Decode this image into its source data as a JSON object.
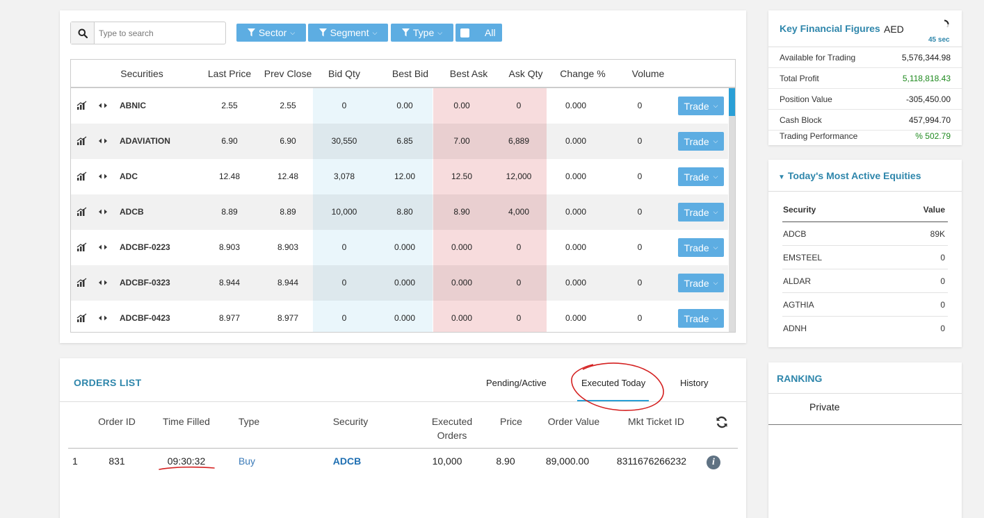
{
  "search": {
    "placeholder": "Type to search"
  },
  "filters": {
    "sector": "Sector",
    "segment": "Segment",
    "type": "Type",
    "all": "All"
  },
  "market_table": {
    "columns": [
      "Securities",
      "Last Price",
      "Prev Close",
      "Bid Qty",
      "Best Bid",
      "Best Ask",
      "Ask Qty",
      "Change %",
      "Volume"
    ],
    "trade_label": "Trade",
    "rows": [
      {
        "security": "ABNIC",
        "last": "2.55",
        "prev": "2.55",
        "bid_qty": "0",
        "best_bid": "0.00",
        "best_ask": "0.00",
        "ask_qty": "0",
        "change": "0.000",
        "volume": "0"
      },
      {
        "security": "ADAVIATION",
        "last": "6.90",
        "prev": "6.90",
        "bid_qty": "30,550",
        "best_bid": "6.85",
        "best_ask": "7.00",
        "ask_qty": "6,889",
        "change": "0.000",
        "volume": "0"
      },
      {
        "security": "ADC",
        "last": "12.48",
        "prev": "12.48",
        "bid_qty": "3,078",
        "best_bid": "12.00",
        "best_ask": "12.50",
        "ask_qty": "12,000",
        "change": "0.000",
        "volume": "0"
      },
      {
        "security": "ADCB",
        "last": "8.89",
        "prev": "8.89",
        "bid_qty": "10,000",
        "best_bid": "8.80",
        "best_ask": "8.90",
        "ask_qty": "4,000",
        "change": "0.000",
        "volume": "0"
      },
      {
        "security": "ADCBF-0223",
        "last": "8.903",
        "prev": "8.903",
        "bid_qty": "0",
        "best_bid": "0.000",
        "best_ask": "0.000",
        "ask_qty": "0",
        "change": "0.000",
        "volume": "0"
      },
      {
        "security": "ADCBF-0323",
        "last": "8.944",
        "prev": "8.944",
        "bid_qty": "0",
        "best_bid": "0.000",
        "best_ask": "0.000",
        "ask_qty": "0",
        "change": "0.000",
        "volume": "0"
      },
      {
        "security": "ADCBF-0423",
        "last": "8.977",
        "prev": "8.977",
        "bid_qty": "0",
        "best_bid": "0.000",
        "best_ask": "0.000",
        "ask_qty": "0",
        "change": "0.000",
        "volume": "0"
      }
    ]
  },
  "orders": {
    "title": "ORDERS LIST",
    "tabs": {
      "pending": "Pending/Active",
      "executed": "Executed Today",
      "history": "History"
    },
    "columns": {
      "order_id": "Order ID",
      "time_filled": "Time Filled",
      "type": "Type",
      "security": "Security",
      "executed_1": "Executed",
      "executed_2": "Orders",
      "price": "Price",
      "order_value": "Order Value",
      "ticket": "Mkt Ticket ID"
    },
    "rows": [
      {
        "index": "1",
        "order_id": "831",
        "time_filled": "09:30:32",
        "type": "Buy",
        "security": "ADCB",
        "executed": "10,000",
        "price": "8.90",
        "order_value": "89,000.00",
        "ticket": "8311676266232"
      }
    ],
    "info_glyph": "i"
  },
  "key_figures": {
    "title": "Key Financial Figures",
    "currency": "AED",
    "timer": "45 sec",
    "rows": [
      {
        "label": "Available for Trading",
        "value": "5,576,344.98"
      },
      {
        "label": "Total Profit",
        "value": "5,118,818.43"
      },
      {
        "label": "Position Value",
        "value": "-305,450.00"
      },
      {
        "label": "Cash Block",
        "value": "457,994.70"
      },
      {
        "label": "Trading Performance",
        "value": "% 502.79"
      }
    ],
    "positive_color": "#1f8a1f"
  },
  "most_active": {
    "title": "Today's Most Active Equities",
    "col_security": "Security",
    "col_value": "Value",
    "rows": [
      {
        "name": "ADCB",
        "value": "89K"
      },
      {
        "name": "EMSTEEL",
        "value": "0"
      },
      {
        "name": "ALDAR",
        "value": "0"
      },
      {
        "name": "AGTHIA",
        "value": "0"
      },
      {
        "name": "ADNH",
        "value": "0"
      }
    ]
  },
  "ranking": {
    "title": "RANKING",
    "item": "Private"
  },
  "colors": {
    "accent": "#5dade2",
    "title": "#2e86ab",
    "annotation": "#d42020"
  }
}
